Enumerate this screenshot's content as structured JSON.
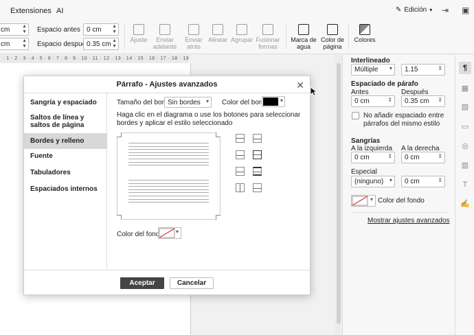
{
  "menubar": {
    "items": [
      "Extensiones",
      "AI"
    ],
    "mode_label": "Edición"
  },
  "toolbar": {
    "left_spin_top": "cm",
    "left_spin_bottom": "cm",
    "space_before_label": "Espacio antes",
    "space_before_value": "0 cm",
    "space_after_label": "Espacio después",
    "space_after_value": "0.35 cm",
    "buttons": {
      "ajuste": "Ajuste",
      "enviar_adelante": "Enviar adelante",
      "enviar_atras": "Enviar atrás",
      "alinear": "Alinear",
      "agrupar": "Agrupar",
      "fusionar": "Fusionar formas",
      "marca": "Marca de agua",
      "color_pagina": "Color de página",
      "colores": "Colores"
    }
  },
  "ruler": {
    "text": "· 1 · 2 · 3 · 4 · 5 · 6 · 7 · 8 · 9 · 10 · 11 · 12 · 13 · 14 · 15 · 16 · 17 · 18 · 19"
  },
  "right_panel": {
    "interlineado_title": "Interlineado",
    "interlineado_type": "Múltiple",
    "interlineado_value": "1.15",
    "espaciado_title": "Espaciado de párafo",
    "antes_label": "Antes",
    "despues_label": "Después",
    "antes_value": "0 cm",
    "despues_value": "0.35 cm",
    "no_space_label": "No añadir espaciado entre párrafos del mismo estilo",
    "sangrias_title": "Sangrías",
    "izq_label": "A la izquierda",
    "der_label": "A la derecha",
    "izq_value": "0 cm",
    "der_value": "0 cm",
    "especial_label": "Especial",
    "especial_value": "(ninguno)",
    "especial_amount": "0 cm",
    "fondo_label": "Color del fondo",
    "advanced_link": "Mostrar ajustes avanzados"
  },
  "dialog": {
    "title": "Párrafo - Ajustes avanzados",
    "nav": [
      "Sangría y espaciado",
      "Saltos de línea y saltos de página",
      "Bordes y relleno",
      "Fuente",
      "Tabuladores",
      "Espaciados internos"
    ],
    "active_index": 2,
    "border_size_label": "Tamaño del borde",
    "border_size_value": "Sin bordes",
    "border_color_label": "Color del borde",
    "border_color": "#000000",
    "hint": "Haga clic en el diagrama o use los botones para seleccionar bordes y aplicar el estilo seleccionado",
    "bg_label": "Color del fondo",
    "ok_label": "Aceptar",
    "cancel_label": "Cancelar"
  },
  "colors": {
    "accent": "#444444",
    "active_nav": "#d8d8d8",
    "no_color_slash": "#e03030"
  }
}
